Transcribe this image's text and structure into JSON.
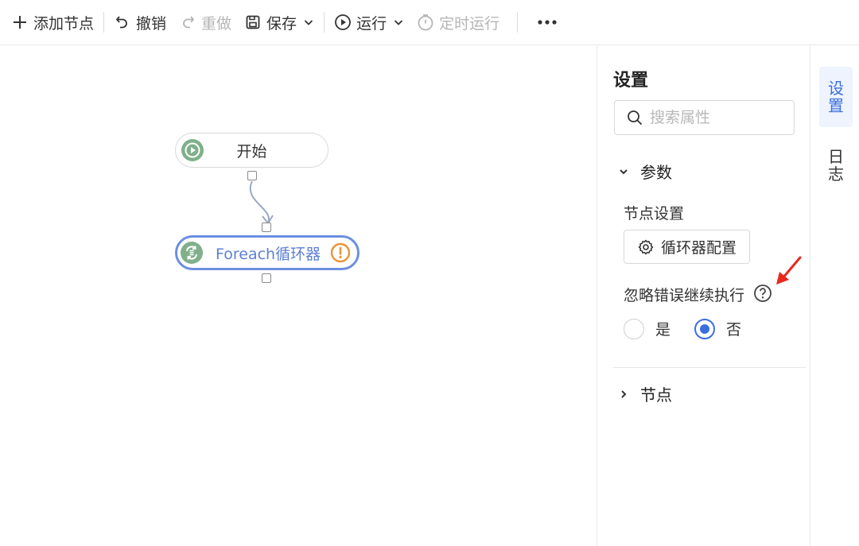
{
  "toolbar": {
    "add_node": "添加节点",
    "undo": "撤销",
    "redo": "重做",
    "save": "保存",
    "run": "运行",
    "scheduled_run": "定时运行"
  },
  "canvas": {
    "start_node_label": "开始",
    "loop_node_label": "Foreach循环器"
  },
  "panel": {
    "title": "设置",
    "search_placeholder": "搜索属性",
    "params_section": "参数",
    "node_settings_label": "节点设置",
    "loop_config_button": "循环器配置",
    "ignore_error_label": "忽略错误继续执行",
    "radio_yes": "是",
    "radio_no": "否",
    "radio_selected": "否",
    "nodes_section": "节点"
  },
  "side_tabs": [
    {
      "label_1": "设",
      "label_2": "置"
    },
    {
      "label_1": "日",
      "label_2": "志"
    }
  ],
  "colors": {
    "accent": "#3b6fe0",
    "loop_border": "#6b8fe0",
    "node_icon_green": "#7fb08a",
    "warning_orange": "#e8943a",
    "annotation_red": "#e8281e"
  }
}
